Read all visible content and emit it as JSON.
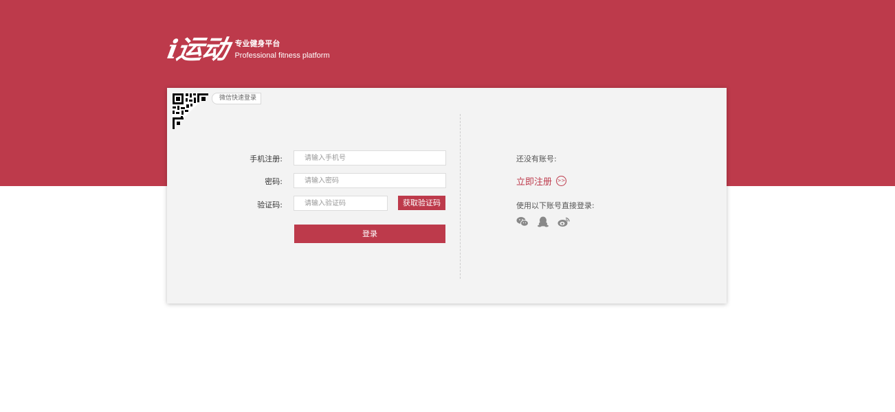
{
  "header": {
    "logo_mark": "i运动",
    "tagline_cn": "专业健身平台",
    "tagline_en": "Professional fitness platform"
  },
  "qr": {
    "wechat_label": "微信快速登录"
  },
  "form": {
    "phone_label": "手机注册:",
    "phone_placeholder": "请输入手机号",
    "password_label": "密码:",
    "password_placeholder": "请输入密码",
    "code_label": "验证码:",
    "code_placeholder": "请输入验证码",
    "get_code_label": "获取验证码",
    "login_label": "登录"
  },
  "side": {
    "no_account": "还没有账号:",
    "register_now": "立即注册",
    "register_arrow": ">>",
    "social_title": "使用以下账号直接登录:",
    "social_icons": [
      "wechat-icon",
      "qq-icon",
      "weibo-icon"
    ]
  },
  "colors": {
    "brand": "#bd3a4b",
    "card_bg": "#f3f3f3"
  }
}
